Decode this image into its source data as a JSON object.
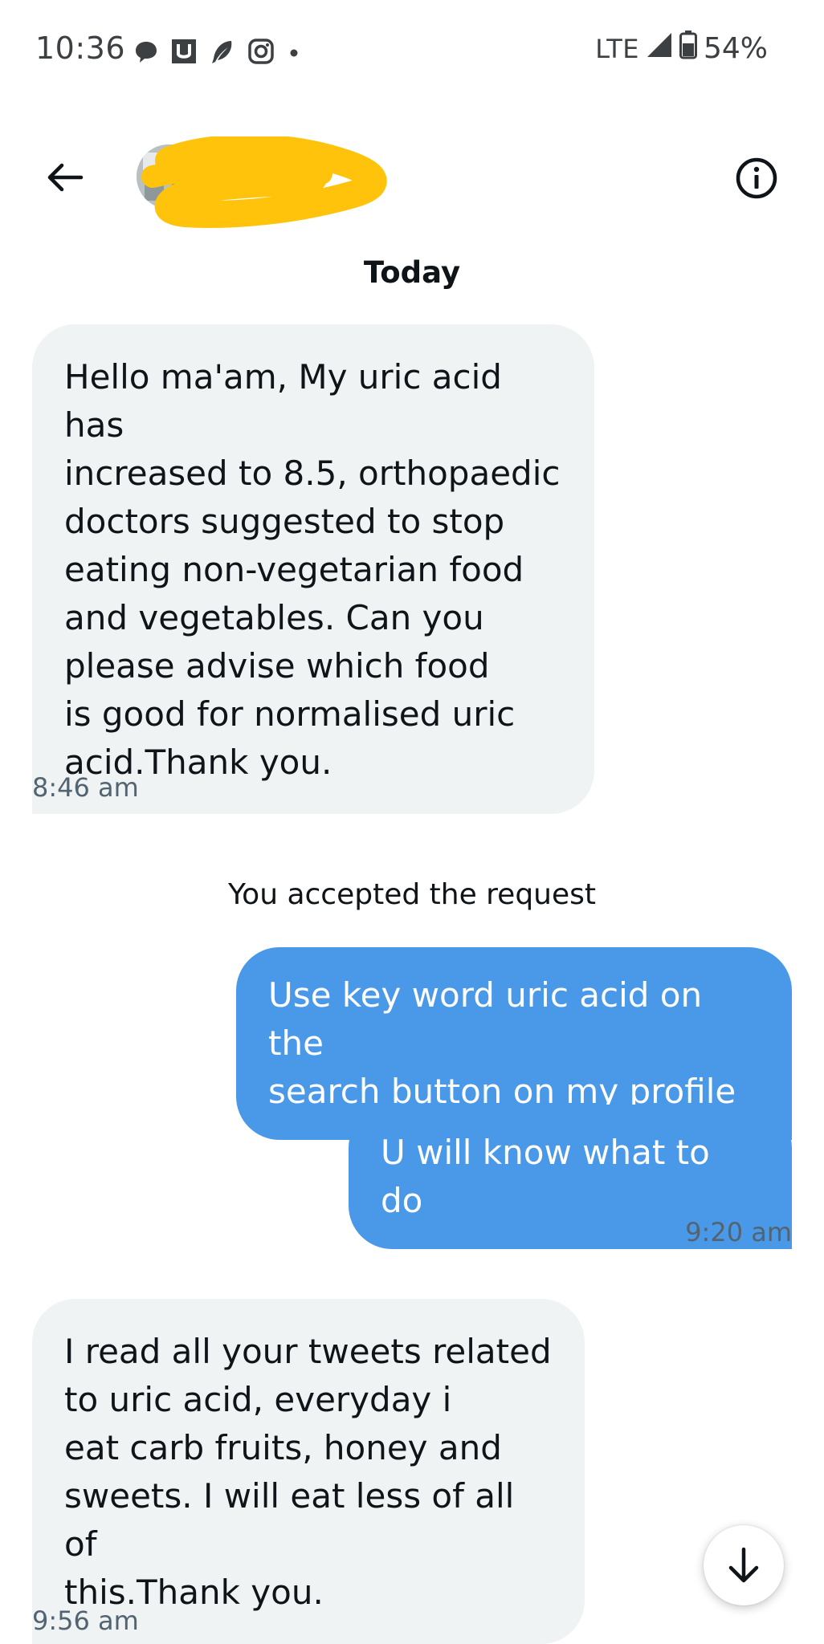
{
  "status_bar": {
    "time": "10:36",
    "network": "LTE",
    "battery": "54%",
    "notification_icons": [
      "chat-bubble-icon",
      "u-app-icon",
      "feather-icon",
      "instagram-icon",
      "dot-icon"
    ]
  },
  "header": {
    "back_icon": "arrow-left-icon",
    "info_icon": "info-circle-icon"
  },
  "conversation": {
    "date_divider": "Today",
    "messages": [
      {
        "direction": "incoming",
        "lines": [
          "Hello ma'am, My uric acid has",
          "increased to 8.5, orthopaedic",
          "doctors suggested to stop",
          "eating non-vegetarian food",
          "and vegetables. Can you",
          "please advise which food",
          "is good for normalised uric",
          "acid.Thank you."
        ],
        "time": "8:46 am"
      },
      {
        "direction": "system",
        "text": "You accepted the request"
      },
      {
        "direction": "outgoing",
        "lines": [
          "Use key word uric acid on the",
          "search button on my profile"
        ]
      },
      {
        "direction": "outgoing",
        "lines": [
          "U will know what to do"
        ],
        "time": "9:20 am"
      },
      {
        "direction": "incoming",
        "lines": [
          "I read all your tweets related",
          "to uric acid, everyday i",
          "eat carb fruits, honey and",
          "sweets. I will eat less of all of",
          "this.Thank you."
        ],
        "time": "9:56 am"
      }
    ]
  },
  "scroll_button_icon": "arrow-down-icon",
  "colors": {
    "incoming_bubble": "#eff3f4",
    "outgoing_bubble": "#4a99e9",
    "timestamp": "#536471",
    "redaction": "#ffc30b"
  }
}
